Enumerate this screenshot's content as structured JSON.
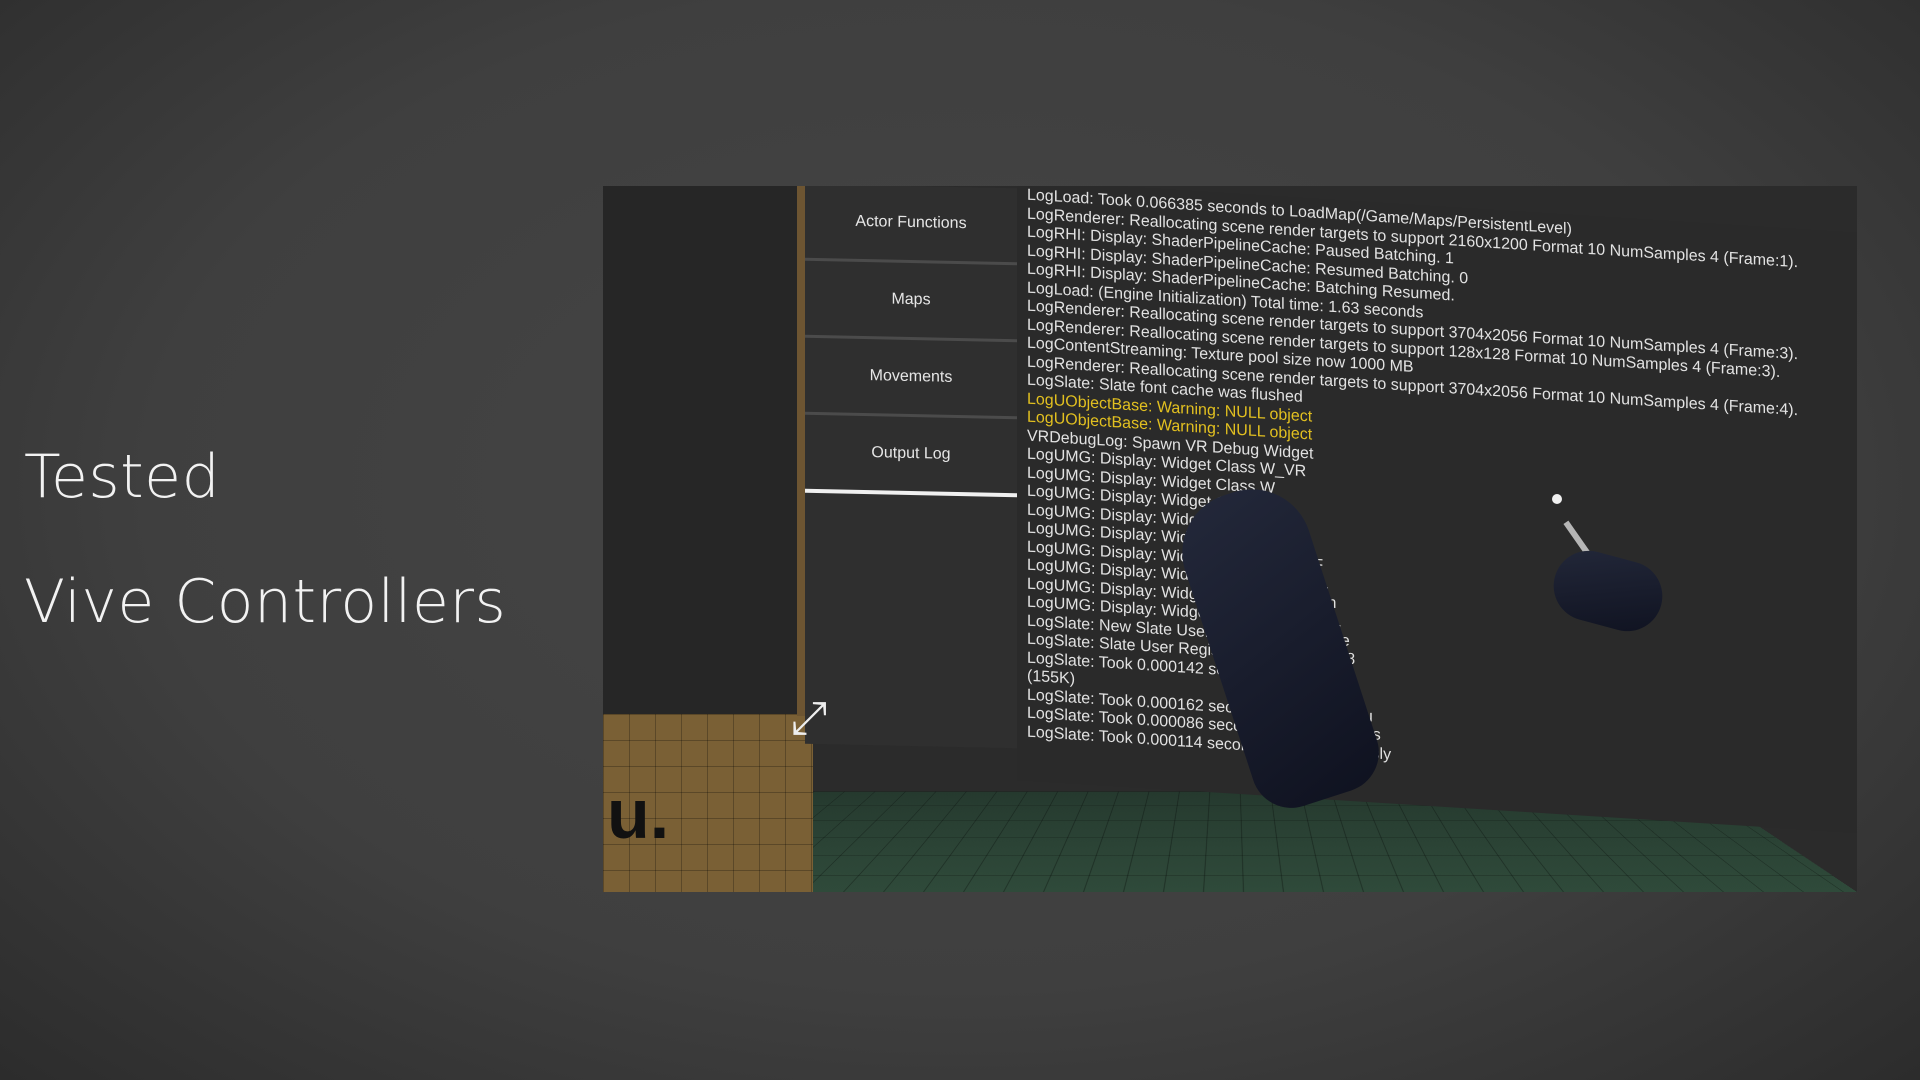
{
  "slide": {
    "line1": "Tested",
    "line2": "Vive Controllers"
  },
  "menu": {
    "items": [
      {
        "label": "Actor Functions"
      },
      {
        "label": "Maps"
      },
      {
        "label": "Movements"
      },
      {
        "label": "Output Log"
      }
    ],
    "active": "Output Log"
  },
  "output_log": {
    "lines": [
      {
        "text": "LogLoad: Took 0.066385 seconds to LoadMap(/Game/Maps/PersistentLevel)",
        "level": "info"
      },
      {
        "text": "LogRenderer: Reallocating scene render targets to support 2160x1200 Format 10 NumSamples 4 (Frame:1).",
        "level": "info"
      },
      {
        "text": "LogRHI: Display: ShaderPipelineCache: Paused Batching. 1",
        "level": "info"
      },
      {
        "text": "LogRHI: Display: ShaderPipelineCache: Resumed Batching. 0",
        "level": "info"
      },
      {
        "text": "LogRHI: Display: ShaderPipelineCache: Batching Resumed.",
        "level": "info"
      },
      {
        "text": "LogLoad: (Engine Initialization) Total time: 1.63 seconds",
        "level": "info"
      },
      {
        "text": "LogRenderer: Reallocating scene render targets to support 3704x2056 Format 10 NumSamples 4 (Frame:3).",
        "level": "info"
      },
      {
        "text": "LogRenderer: Reallocating scene render targets to support 128x128 Format 10 NumSamples 4 (Frame:3).",
        "level": "info"
      },
      {
        "text": "LogContentStreaming: Texture pool size now 1000 MB",
        "level": "info"
      },
      {
        "text": "LogRenderer: Reallocating scene render targets to support 3704x2056 Format 10 NumSamples 4 (Frame:4).",
        "level": "info"
      },
      {
        "text": "LogSlate: Slate font cache was flushed",
        "level": "info"
      },
      {
        "text": "LogUObjectBase: Warning: NULL object",
        "level": "warning"
      },
      {
        "text": "LogUObjectBase: Warning: NULL object",
        "level": "warning"
      },
      {
        "text": "VRDebugLog: Spawn VR Debug Widget",
        "level": "info"
      },
      {
        "text": "LogUMG: Display: Widget Class W_VR",
        "level": "info"
      },
      {
        "text": "LogUMG: Display: Widget Class W",
        "level": "info"
      },
      {
        "text": "LogUMG: Display: Widget Class W",
        "level": "info"
      },
      {
        "text": "LogUMG: Display: Widget Class W",
        "level": "info"
      },
      {
        "text": "LogUMG: Display: Widget Class W_Con",
        "level": "info"
      },
      {
        "text": "LogUMG: Display: Widget Class W_RunF",
        "level": "info"
      },
      {
        "text": "LogUMG: Display: Widget Class W_LoadL",
        "level": "info"
      },
      {
        "text": "LogUMG: Display: Widget Class W_Movem",
        "level": "info"
      },
      {
        "text": "LogUMG: Display: Widget Class W_OutputL",
        "level": "info"
      },
      {
        "text": "LogSlate: New Slate User Created. User Inde",
        "level": "info"
      },
      {
        "text": "LogSlate: Slate User Registered. User Index 8",
        "level": "info"
      },
      {
        "text": "LogSlate: Took 0.000142 seconds to synchron",
        "level": "info"
      },
      {
        "text": "(155K)",
        "level": "info"
      },
      {
        "text": "LogSlate: Took 0.000162 seconds to synchronou",
        "level": "info"
      },
      {
        "text": "LogSlate: Took 0.000086 seconds to synchronous",
        "level": "info"
      },
      {
        "text": "LogSlate: Took 0.000114 seconds to synchronously",
        "level": "info"
      }
    ]
  },
  "scene": {
    "box_mark": "u."
  }
}
